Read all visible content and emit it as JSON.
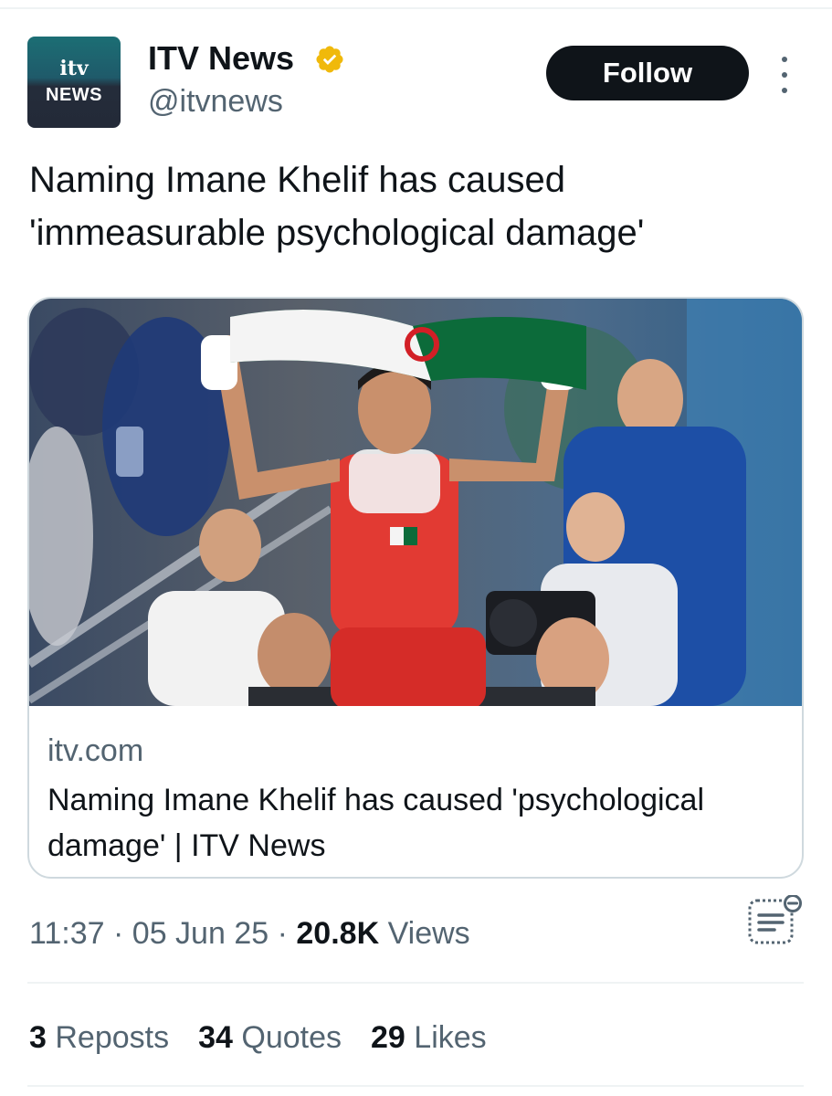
{
  "account": {
    "avatar_brand": "itv",
    "avatar_sub": "NEWS",
    "display_name": "ITV News",
    "handle": "@itvnews",
    "verified_icon": "verified-gold-badge-icon",
    "verified_color": "#f0b90b"
  },
  "actions": {
    "follow_label": "Follow",
    "more_icon": "more-vertical-icon"
  },
  "tweet": {
    "text": "Naming Imane Khelif has caused 'immeasurable psychological damage'"
  },
  "card": {
    "image_icon": "boxer-celebration-photo",
    "domain": "itv.com",
    "title": "Naming Imane Khelif has caused 'psychological damage' | ITV News"
  },
  "meta": {
    "time": "11:37",
    "separator": "·",
    "date": "05 Jun 25",
    "views_count": "20.8K",
    "views_label": "Views",
    "notes_icon": "community-notes-icon"
  },
  "stats": {
    "reposts_count": "3",
    "reposts_label": "Reposts",
    "quotes_count": "34",
    "quotes_label": "Quotes",
    "likes_count": "29",
    "likes_label": "Likes"
  },
  "colors": {
    "text_primary": "#0f1419",
    "text_secondary": "#536471",
    "border": "#cfd9de",
    "follow_bg": "#0f1419"
  }
}
